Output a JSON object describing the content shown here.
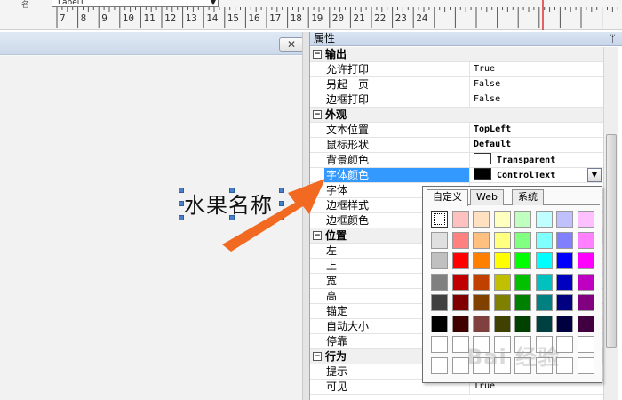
{
  "ruler": {
    "combo_prefix": "名",
    "combo_value": "Label1",
    "ticks": [
      "7",
      "8",
      "9",
      "10",
      "11",
      "12",
      "13",
      "14",
      "15",
      "16",
      "17",
      "18",
      "19",
      "20",
      "21",
      "22",
      "23",
      "24"
    ]
  },
  "designer": {
    "close_label": "✕",
    "label_text": "水果名称"
  },
  "properties": {
    "title": "属性",
    "pin": "ᛘ",
    "categories": {
      "output": "输出",
      "appearance": "外观",
      "position": "位置",
      "behavior": "行为"
    },
    "rows": {
      "allow_print": {
        "name": "允许打印",
        "value": "True"
      },
      "new_page": {
        "name": "另起一页",
        "value": "False"
      },
      "border_print": {
        "name": "边框打印",
        "value": "False"
      },
      "text_position": {
        "name": "文本位置",
        "value": "TopLeft"
      },
      "cursor": {
        "name": "鼠标形状",
        "value": "Default"
      },
      "bg_color": {
        "name": "背景颜色",
        "value": "Transparent"
      },
      "font_color": {
        "name": "字体颜色",
        "value": "ControlText"
      },
      "font": {
        "name": "字体"
      },
      "border_style": {
        "name": "边框样式"
      },
      "border_color": {
        "name": "边框颜色"
      },
      "left": {
        "name": "左"
      },
      "top": {
        "name": "上"
      },
      "width": {
        "name": "宽"
      },
      "height": {
        "name": "高"
      },
      "anchor": {
        "name": "锚定"
      },
      "autosize": {
        "name": "自动大小"
      },
      "dock": {
        "name": "停靠"
      },
      "tooltip": {
        "name": "提示"
      },
      "visible": {
        "name": "可见",
        "value": "True"
      }
    }
  },
  "color_popup": {
    "tabs": [
      "自定义",
      "Web",
      "系统"
    ],
    "active_tab": "自定义",
    "swatches": [
      [
        "#ffffff",
        "#ffc0c0",
        "#ffe0c0",
        "#ffffc0",
        "#c0ffc0",
        "#c0ffff",
        "#c0c0ff",
        "#ffc0ff"
      ],
      [
        "#e0e0e0",
        "#ff8080",
        "#ffc080",
        "#ffff80",
        "#80ff80",
        "#80ffff",
        "#8080ff",
        "#ff80ff"
      ],
      [
        "#c0c0c0",
        "#ff0000",
        "#ff8000",
        "#ffff00",
        "#00ff00",
        "#00ffff",
        "#0000ff",
        "#ff00ff"
      ],
      [
        "#808080",
        "#c00000",
        "#c04000",
        "#c0c000",
        "#00c000",
        "#00c0c0",
        "#0000c0",
        "#c000c0"
      ],
      [
        "#404040",
        "#800000",
        "#804000",
        "#808000",
        "#008000",
        "#008080",
        "#000080",
        "#800080"
      ],
      [
        "#000000",
        "#400000",
        "#804040",
        "#404000",
        "#004000",
        "#004040",
        "#000040",
        "#400040"
      ],
      [
        "#ffffff",
        "#ffffff",
        "#ffffff",
        "#ffffff",
        "#ffffff",
        "#ffffff",
        "#ffffff",
        "#ffffff"
      ],
      [
        "#ffffff",
        "#ffffff",
        "#ffffff",
        "#ffffff",
        "#ffffff",
        "#ffffff",
        "#ffffff",
        "#ffffff"
      ]
    ]
  },
  "colors": {
    "selection": "#3399ff",
    "arrow": "#f26a21",
    "ruler_marker": "#e03030"
  },
  "watermark": "Bai 经验"
}
